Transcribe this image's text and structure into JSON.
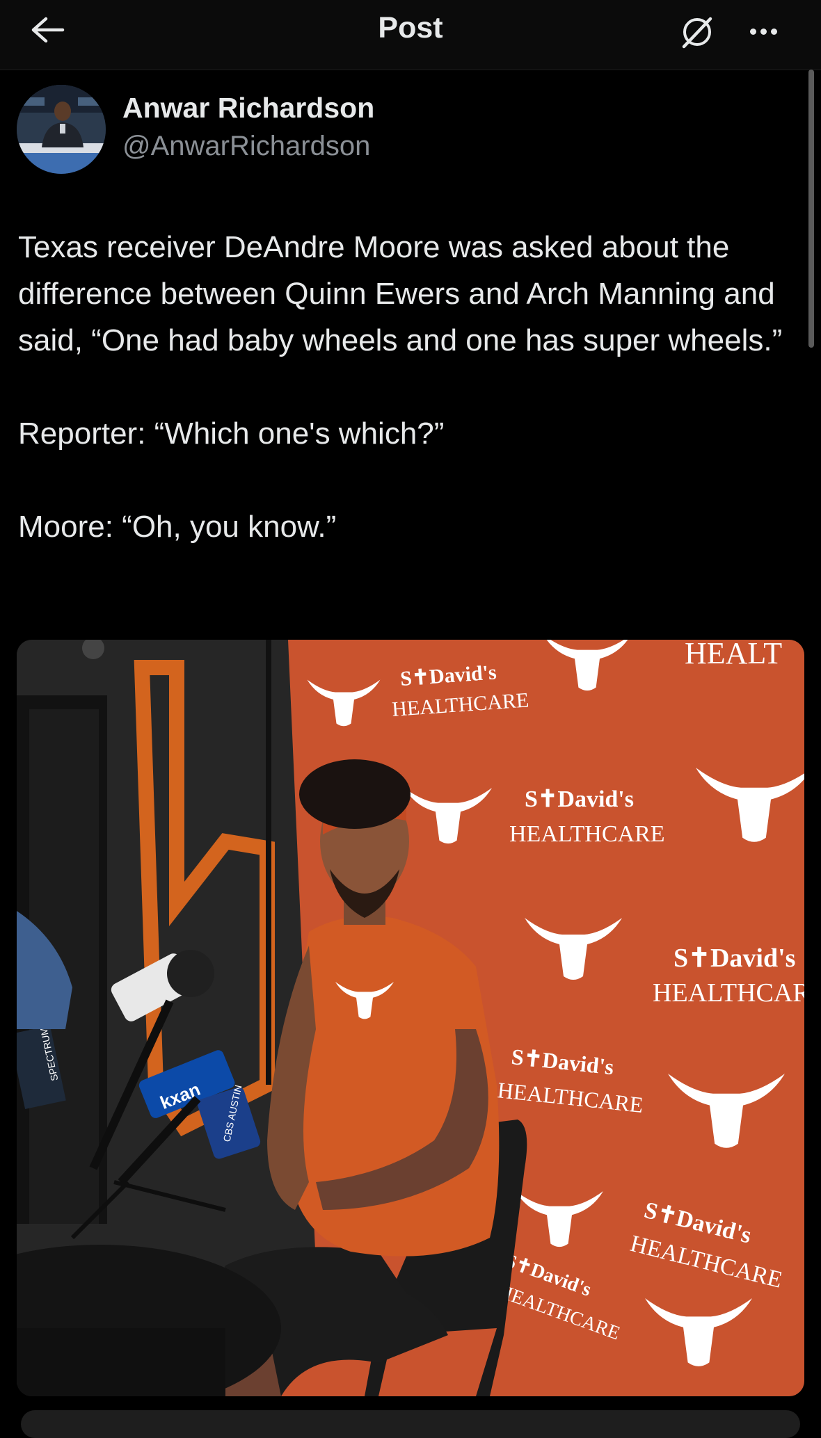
{
  "header": {
    "title": "Post",
    "back_icon": "arrow-left-icon",
    "grok_icon": "grok-icon",
    "more_icon": "more-horizontal-icon"
  },
  "author": {
    "name": "Anwar Richardson",
    "handle": "@AnwarRichardson"
  },
  "post": {
    "paragraphs": [
      "Texas receiver DeAndre Moore was asked about the difference between Quinn Ewers and Arch Manning and said, “One had baby wheels and one has super wheels.”",
      "Reporter: “Which one's which?”",
      "Moore: “Oh, you know.”"
    ]
  },
  "photo": {
    "backdrop_brand_top": "S✝David's",
    "backdrop_brand_bottom": "HEALTHCARE",
    "backdrop_partial_top_right": "HEALT",
    "mic_flag_kxan": "kxan",
    "mic_flag_cbs": "CBS AUSTIN",
    "mic_flag_spectrum": "SPECTRUM NEWS",
    "colors": {
      "backdrop": "#c9532e",
      "shirt": "#d25a24",
      "wall": "#262626"
    }
  }
}
